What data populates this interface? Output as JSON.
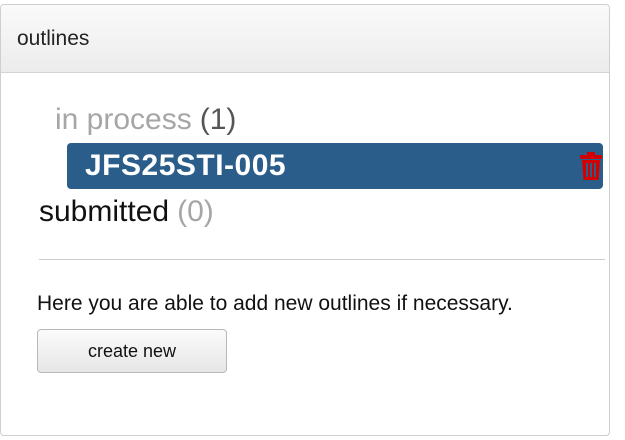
{
  "panel": {
    "title": "outlines"
  },
  "in_process": {
    "label": "in process",
    "count": "(1)",
    "items": [
      {
        "code": "JFS25STI-005"
      }
    ]
  },
  "submitted": {
    "label": "submitted",
    "count": "(0)"
  },
  "info": {
    "text": "Here you are able to add new outlines if necessary."
  },
  "actions": {
    "create_label": "create new"
  },
  "icons": {
    "delete": "trash-icon"
  },
  "colors": {
    "selected_bg": "#2a5d8a",
    "delete_icon": "#d40000",
    "muted_text": "#a6a6a6"
  }
}
